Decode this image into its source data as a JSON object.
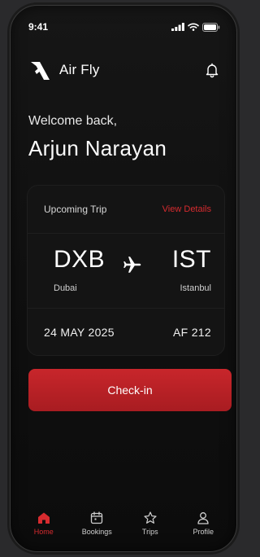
{
  "status": {
    "time": "9:41",
    "icons": [
      "signal-icon",
      "wifi-icon",
      "battery-icon"
    ]
  },
  "brand": {
    "name": "Air Fly",
    "logo": "air-fly-logo-icon"
  },
  "header": {
    "notification_icon": "bell-icon"
  },
  "greeting": {
    "welcome": "Welcome back,",
    "user_name": "Arjun Narayan"
  },
  "trip": {
    "title": "Upcoming Trip",
    "view_details": "View Details",
    "origin_code": "DXB",
    "origin_city": "Dubai",
    "destination_code": "IST",
    "destination_city": "Istanbul",
    "date": "24 MAY 2025",
    "flight": "AF 212"
  },
  "actions": {
    "checkin_label": "Check-in"
  },
  "tabs": [
    {
      "label": "Home",
      "icon": "home-icon",
      "active": true
    },
    {
      "label": "Bookings",
      "icon": "calendar-icon",
      "active": false
    },
    {
      "label": "Trips",
      "icon": "star-icon",
      "active": false
    },
    {
      "label": "Profile",
      "icon": "user-icon",
      "active": false
    }
  ],
  "colors": {
    "accent": "#d72b2f",
    "button": "#b82227",
    "background": "#101010",
    "card": "#141414"
  }
}
